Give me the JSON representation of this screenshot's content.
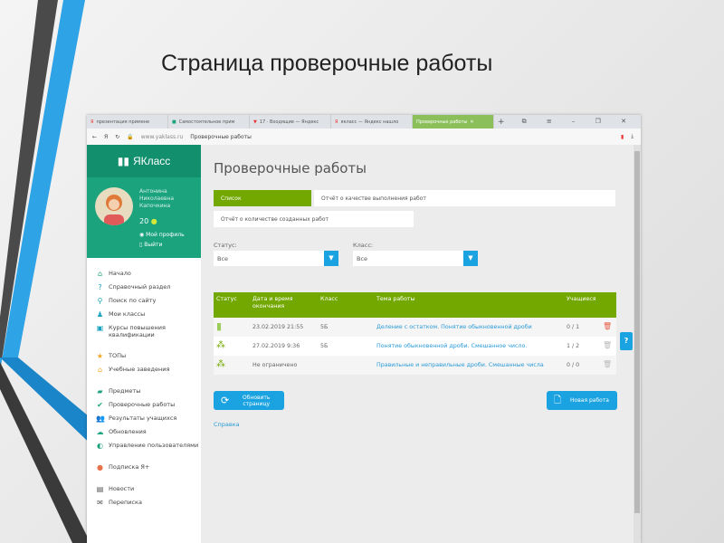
{
  "slide_title": "Страница проверочные работы",
  "browser": {
    "tabs": [
      "презентация примене",
      "Самостоятельное прим",
      "17 · Входящие — Яндекс",
      "якласс — Яндекс нашло",
      "Проверочные работы"
    ],
    "url": "www.yaklass.ru",
    "page_title": "Проверочные работы"
  },
  "sidebar": {
    "logo": "ЯКласс",
    "user": [
      "Антонина",
      "Николаевна",
      "Капочкина"
    ],
    "points": "20",
    "profile": "Мой профиль",
    "logout": "Выйти",
    "items": [
      {
        "label": "Начало",
        "icon": "home-icon",
        "color": "#1aa37d"
      },
      {
        "label": "Справочный раздел",
        "icon": "help-circle-icon",
        "color": "#1aa3c0"
      },
      {
        "label": "Поиск по сайту",
        "icon": "search-icon",
        "color": "#1aa3c0"
      },
      {
        "label": "Мои классы",
        "icon": "class-icon",
        "color": "#1aa3c0"
      },
      {
        "label": "Курсы повышения квалификации",
        "icon": "course-icon",
        "color": "#1aa3c0"
      },
      {
        "label": "ТОПы",
        "icon": "star-icon",
        "color": "#f5a623"
      },
      {
        "label": "Учебные заведения",
        "icon": "institution-icon",
        "color": "#f5a623"
      },
      {
        "label": "Предметы",
        "icon": "subjects-icon",
        "color": "#1aa37d"
      },
      {
        "label": "Проверочные работы",
        "icon": "check-icon",
        "color": "#1aa37d"
      },
      {
        "label": "Результаты учащихся",
        "icon": "users-icon",
        "color": "#1aa37d"
      },
      {
        "label": "Обновления",
        "icon": "cloud-icon",
        "color": "#1aa37d"
      },
      {
        "label": "Управление пользователями",
        "icon": "user-manage-icon",
        "color": "#1aa37d"
      },
      {
        "label": "Подписка Я+",
        "icon": "subscription-icon",
        "color": "#e8734a"
      },
      {
        "label": "Новости",
        "icon": "news-icon",
        "color": "#555"
      },
      {
        "label": "Переписка",
        "icon": "mail-icon",
        "color": "#555"
      }
    ]
  },
  "main": {
    "title": "Проверочные работы",
    "tabs": [
      "Список",
      "Отчёт о качестве выполнения работ",
      "Отчёт о количестве созданных работ"
    ],
    "status_label": "Статус:",
    "status_value": "Все",
    "class_label": "Класс:",
    "class_value": "Все",
    "columns": [
      "Статус",
      "Дата и время окончания",
      "Класс",
      "Тема работы",
      "Учащиеся"
    ],
    "rows": [
      {
        "date": "23.02.2019 21:55",
        "class": "5Б",
        "topic": "Деление с остатком. Понятие обыкновенной дроби",
        "students": "0 / 1"
      },
      {
        "date": "27.02.2019 9:36",
        "class": "5Б",
        "topic": "Понятие обыкновенной дроби. Смешанное число.",
        "students": "1 / 2"
      },
      {
        "date": "Не ограничено",
        "class": "",
        "topic": "Правильные и неправильные дроби. Смешанные числа",
        "students": "0 / 0"
      }
    ],
    "refresh": "Обновить страницу",
    "new_work": "Новая работа",
    "help": "Справка",
    "help_button": "?"
  }
}
